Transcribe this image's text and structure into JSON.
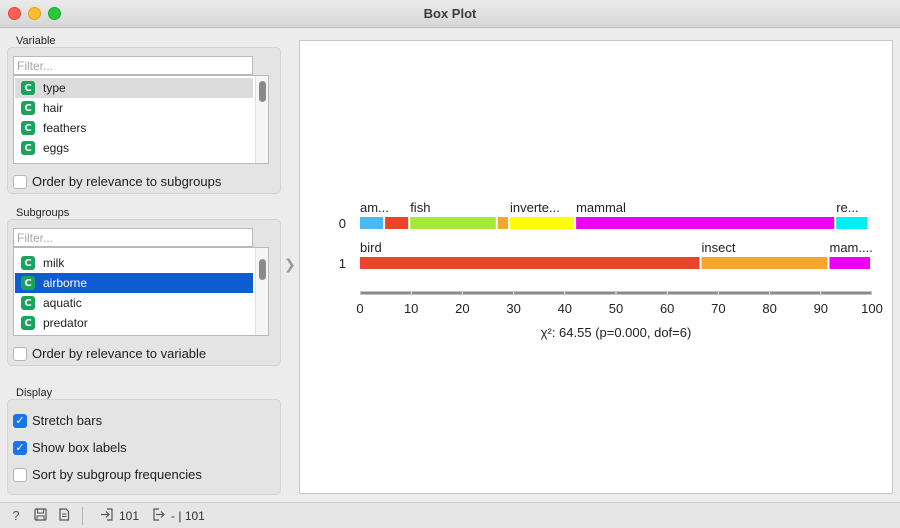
{
  "window": {
    "title": "Box Plot"
  },
  "variable": {
    "section_label": "Variable",
    "filter_placeholder": "Filter...",
    "items": [
      {
        "label": "type",
        "icon": "categorical-icon",
        "icon_text": "C"
      },
      {
        "label": "hair",
        "icon": "categorical-icon",
        "icon_text": "C"
      },
      {
        "label": "feathers",
        "icon": "categorical-icon",
        "icon_text": "C"
      },
      {
        "label": "eggs",
        "icon": "categorical-icon",
        "icon_text": "C"
      }
    ],
    "selected": "type",
    "order_label": "Order by relevance to subgroups",
    "order_checked": false
  },
  "subgroups": {
    "section_label": "Subgroups",
    "filter_placeholder": "Filter...",
    "items": [
      {
        "label": "milk",
        "icon": "categorical-icon",
        "icon_text": "C"
      },
      {
        "label": "airborne",
        "icon": "categorical-icon",
        "icon_text": "C"
      },
      {
        "label": "aquatic",
        "icon": "categorical-icon",
        "icon_text": "C"
      },
      {
        "label": "predator",
        "icon": "categorical-icon",
        "icon_text": "C"
      }
    ],
    "selected": "airborne",
    "order_label": "Order by relevance to variable",
    "order_checked": false
  },
  "display": {
    "section_label": "Display",
    "stretch_bars": {
      "label": "Stretch bars",
      "checked": true
    },
    "show_box_labels": {
      "label": "Show box labels",
      "checked": true
    },
    "sort_by_freq": {
      "label": "Sort by subgroup frequencies",
      "checked": false
    }
  },
  "status_bar": {
    "icons": [
      "help-icon",
      "save-icon",
      "report-icon"
    ],
    "input_count": "101",
    "output_text": "- | 101"
  },
  "colors": {
    "amphibian": "#4db8f0",
    "bird": "#e8452c",
    "fish": "#a4e83a",
    "insect": "#f2a730",
    "invertebrate": "#ffff00",
    "mammal": "#f000f0",
    "reptile": "#00f0f0",
    "selection_blue": "#0f5bd0"
  },
  "chart_data": {
    "type": "bar",
    "subtype": "stretched-stacked-bar",
    "rows": [
      {
        "label": "0",
        "segments": [
          {
            "name": "amphibian",
            "label": "am...",
            "value": 4.9
          },
          {
            "name": "bird",
            "label": "",
            "value": 4.9
          },
          {
            "name": "fish",
            "label": "fish",
            "value": 17.1
          },
          {
            "name": "insect",
            "label": "",
            "value": 2.4
          },
          {
            "name": "invertebrate",
            "label": "invertebrate",
            "value": 12.9
          },
          {
            "name": "mammal",
            "label": "mammal",
            "value": 50.8
          },
          {
            "name": "reptile",
            "label": "reptile",
            "value": 6.5
          }
        ]
      },
      {
        "label": "1",
        "segments": [
          {
            "name": "bird",
            "label": "bird",
            "value": 66.7
          },
          {
            "name": "insect",
            "label": "insect",
            "value": 25.0
          },
          {
            "name": "mammal",
            "label": "mam...",
            "value": 8.3
          }
        ]
      }
    ],
    "xlim": [
      0,
      100
    ],
    "xticks": [
      0,
      10,
      20,
      30,
      40,
      50,
      60,
      70,
      80,
      90,
      100
    ],
    "stat_text": "χ²: 64.55 (p=0.000, dof=6)"
  }
}
